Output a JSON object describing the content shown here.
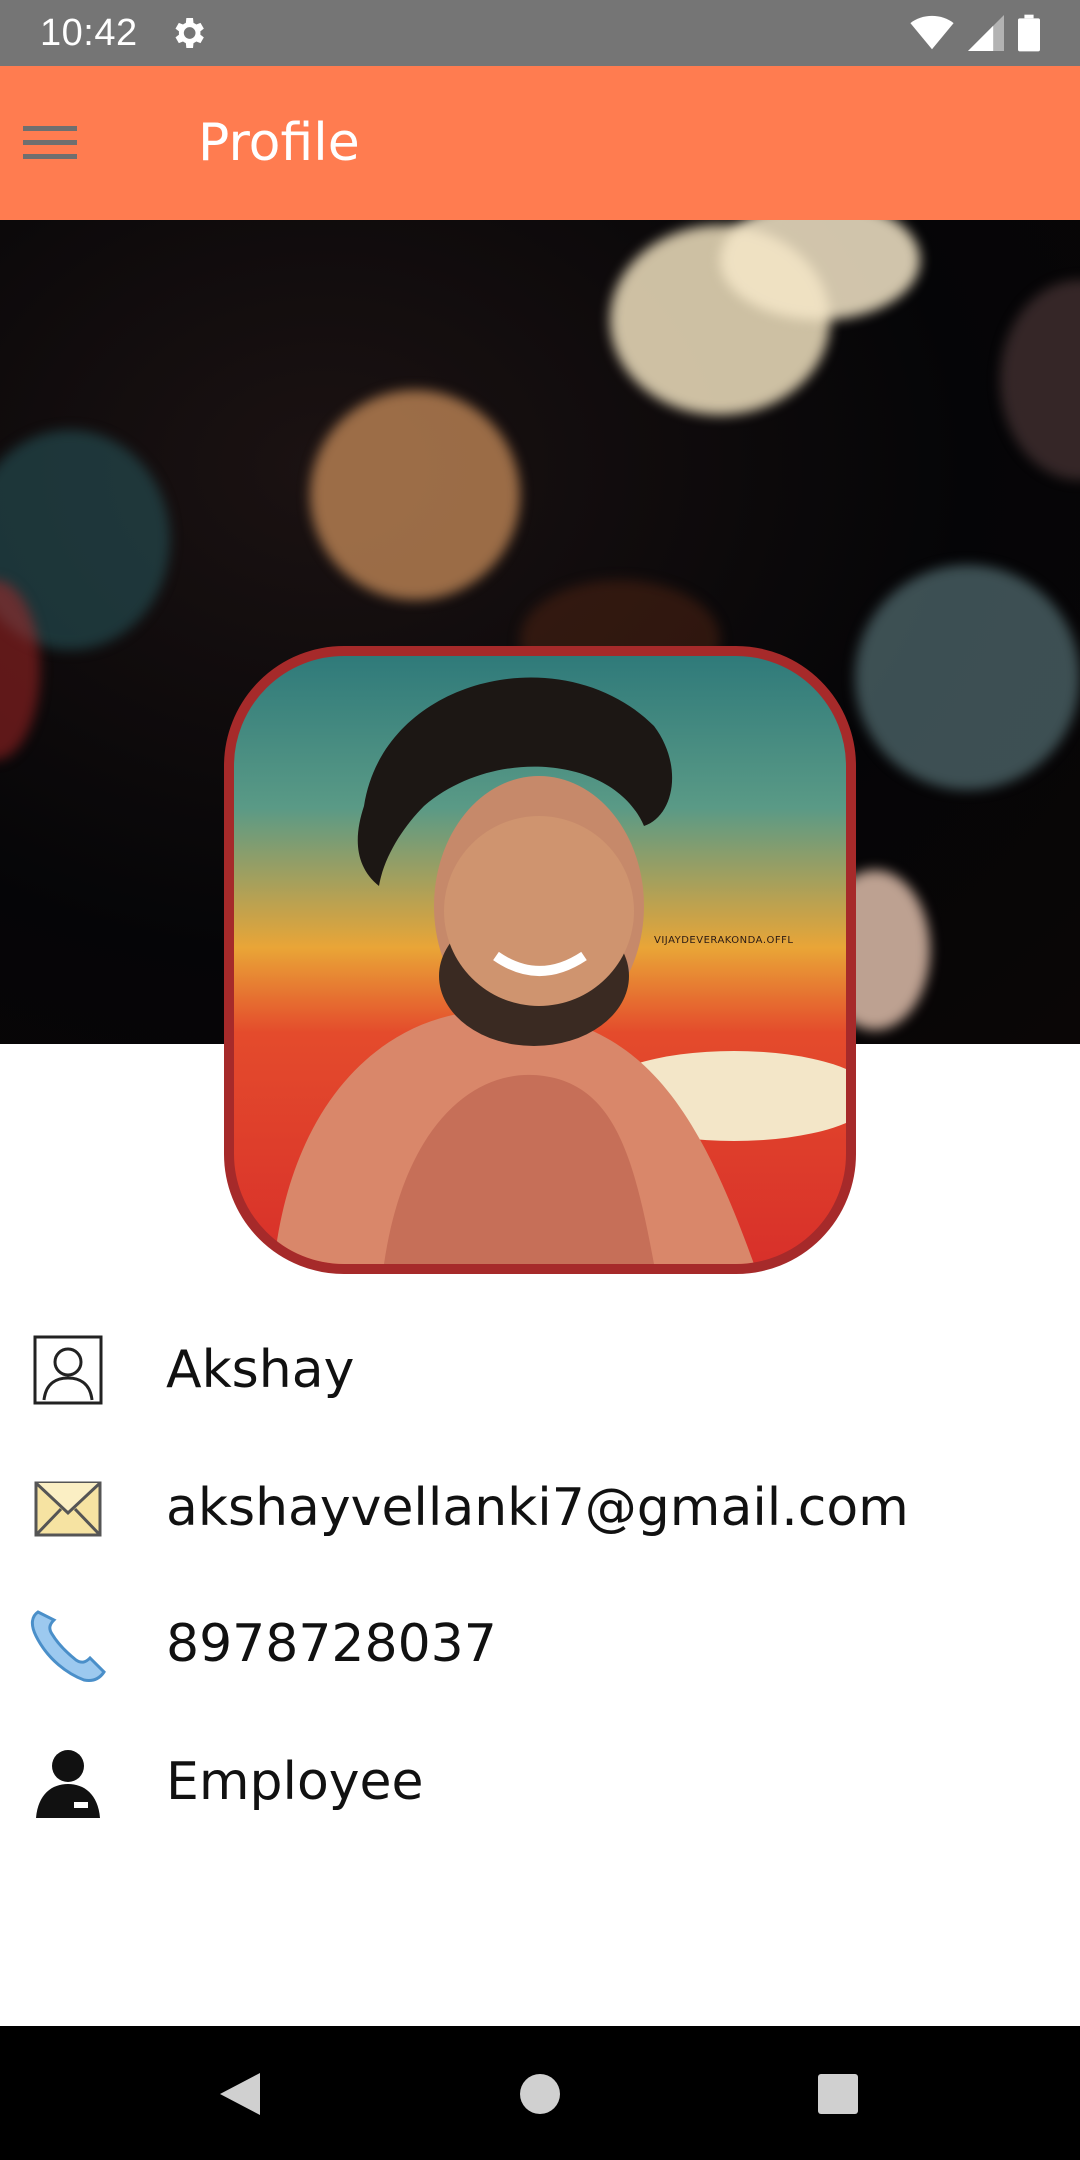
{
  "status_bar": {
    "time": "10:42",
    "icons": [
      "gear-icon",
      "wifi-icon",
      "signal-icon",
      "battery-icon"
    ]
  },
  "app_bar": {
    "title": "Profile",
    "menu_icon": "hamburger-menu-icon",
    "background_color": "#FF7C50"
  },
  "profile": {
    "avatar_watermark": "VIJAYDEVERAKONDA.OFFL",
    "avatar_border_color": "#A62A2A",
    "fields": [
      {
        "icon": "person-outline-icon",
        "value": "Akshay"
      },
      {
        "icon": "envelope-icon",
        "value": "akshayvellanki7@gmail.com"
      },
      {
        "icon": "phone-icon",
        "value": "8978728037"
      },
      {
        "icon": "employee-icon",
        "value": "Employee"
      }
    ]
  },
  "nav_bar": {
    "buttons": [
      "back-icon",
      "home-icon",
      "recents-icon"
    ]
  }
}
